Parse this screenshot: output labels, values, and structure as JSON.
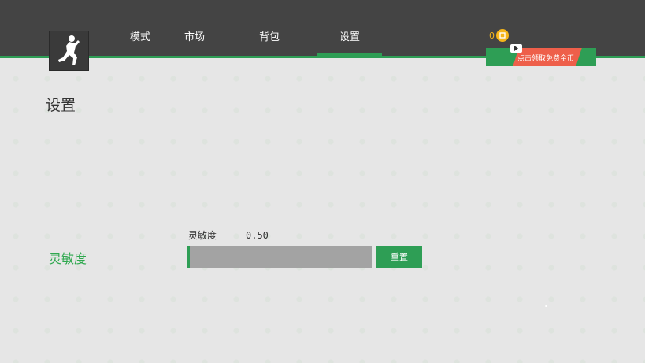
{
  "nav": {
    "tabs": [
      {
        "label": "模式"
      },
      {
        "label": "市场"
      },
      {
        "label": "背包"
      },
      {
        "label": "设置"
      }
    ],
    "active_index": 3
  },
  "coins": {
    "count": "0",
    "icon": "coin-icon"
  },
  "banner": {
    "text": "点击领取免费金币",
    "icon": "play-icon"
  },
  "page": {
    "title": "设置"
  },
  "sensitivity": {
    "label": "灵敏度",
    "caption": "灵敏度",
    "value_text": "0.50",
    "fill_fraction": 0.01,
    "reset_label": "重置"
  },
  "colors": {
    "accent": "#2e9e55",
    "topbar": "#444444",
    "coin": "#f5b51a",
    "banner_red": "#ee5f4a"
  }
}
